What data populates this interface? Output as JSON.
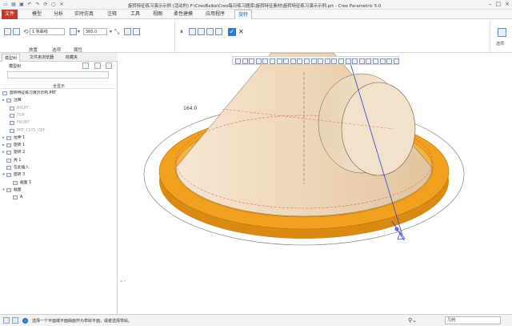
{
  "titlebar": {
    "title": "旋转特征练习演示示例 (活动的) F:\\CreoBaike\\Creo每日练习题库\\旋转特征素材\\旋转特征练习演示示例.prt - Creo Parametric 5.0",
    "minimize": "–",
    "maximize": "□",
    "close": "×"
  },
  "ribbon_tabs": [
    {
      "label": "文件"
    },
    {
      "label": "模型"
    },
    {
      "label": "分析"
    },
    {
      "label": "实时仿真"
    },
    {
      "label": "注释"
    },
    {
      "label": "工具"
    },
    {
      "label": "视图"
    },
    {
      "label": "柔性建模"
    },
    {
      "label": "应用程序"
    },
    {
      "label": "旋转"
    }
  ],
  "ribbon": {
    "sketch_select": "1 条曲线",
    "angle_value": "360.0",
    "groups": {
      "placement": "放置",
      "options": "选项",
      "properties": "属性"
    },
    "options_label": "选项"
  },
  "left_panel": {
    "tabs": [
      {
        "label": "模型树"
      },
      {
        "label": "文件夹浏览器"
      },
      {
        "label": "收藏夹"
      }
    ],
    "tree_title": "模型树",
    "show_all": "全显示",
    "tree_items": [
      {
        "label": "旋转特征练习演示示例.PRT",
        "expand": "",
        "dim": false
      },
      {
        "label": "注释",
        "expand": "▸",
        "dim": false
      },
      {
        "label": "RIGHT",
        "expand": "",
        "dim": true
      },
      {
        "label": "TOP",
        "expand": "",
        "dim": true
      },
      {
        "label": "FRONT",
        "expand": "",
        "dim": true
      },
      {
        "label": "PRT_CSYS_DEF",
        "expand": "",
        "dim": true
      },
      {
        "label": "拉伸 1",
        "expand": "▸",
        "dim": false
      },
      {
        "label": "旋转 1",
        "expand": "▸",
        "dim": false
      },
      {
        "label": "旋转 2",
        "expand": "▸",
        "dim": false
      },
      {
        "label": "壳 1",
        "expand": "",
        "dim": false
      },
      {
        "label": "在此插入",
        "expand": "",
        "dim": false
      },
      {
        "label": "旋转 3",
        "expand": "▾",
        "dim": false
      },
      {
        "label": "截面 1",
        "expand": "",
        "dim": false
      },
      {
        "label": "截面",
        "expand": "▾",
        "dim": false
      },
      {
        "label": "A",
        "expand": "",
        "dim": false
      }
    ]
  },
  "viewport": {
    "dimension_label": "164.0"
  },
  "statusbar": {
    "message": "选择一个平面或平面曲面作为草绘平面，或者选择草绘。",
    "filter": "几何"
  },
  "colors": {
    "accent_blue": "#2f7bd4",
    "file_tab": "#c0392b",
    "cone_fill": "#f2dcc1",
    "base_orange": "#f2a11f"
  }
}
